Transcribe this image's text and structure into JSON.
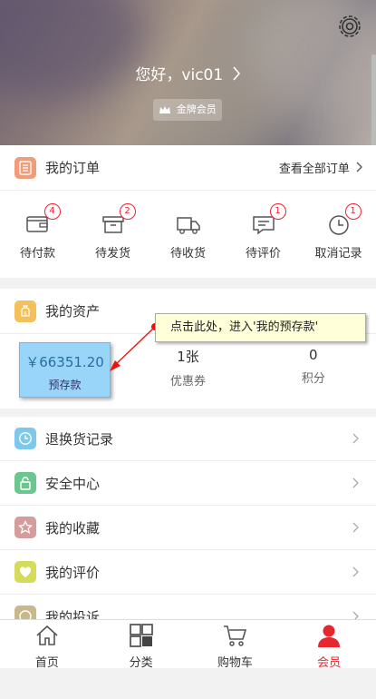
{
  "header": {
    "greeting": "您好，vic01",
    "member_badge": "金牌会员"
  },
  "orders": {
    "title": "我的订单",
    "view_all": "查看全部订单",
    "items": [
      {
        "label": "待付款",
        "count": "4"
      },
      {
        "label": "待发货",
        "count": "2"
      },
      {
        "label": "待收货",
        "count": ""
      },
      {
        "label": "待评价",
        "count": "1"
      },
      {
        "label": "取消记录",
        "count": "1"
      }
    ]
  },
  "assets": {
    "title": "我的资产",
    "deposit_value": "￥66351.20",
    "deposit_label": "预存款",
    "coupon_value": "1张",
    "coupon_label": "优惠券",
    "points_value": "0",
    "points_label": "积分"
  },
  "tooltip": "点击此处，进入'我的预存款'",
  "menu": [
    {
      "label": "退换货记录",
      "icon": "clock-icon",
      "color": "#7ec8ec"
    },
    {
      "label": "安全中心",
      "icon": "lock-icon",
      "color": "#6cc690"
    },
    {
      "label": "我的收藏",
      "icon": "star-icon",
      "color": "#d59c9c"
    },
    {
      "label": "我的评价",
      "icon": "heart-icon",
      "color": "#d5dc5c"
    },
    {
      "label": "我的投诉",
      "icon": "complaint-icon",
      "color": "#c8b88c"
    }
  ],
  "tabbar": [
    {
      "label": "首页",
      "icon": "home-icon"
    },
    {
      "label": "分类",
      "icon": "category-icon"
    },
    {
      "label": "购物车",
      "icon": "cart-icon"
    },
    {
      "label": "会员",
      "icon": "user-icon"
    }
  ],
  "colors": {
    "accent": "#e8262f",
    "order_icon_bg": "#f29c7a",
    "asset_icon_bg": "#f5bf5a"
  }
}
